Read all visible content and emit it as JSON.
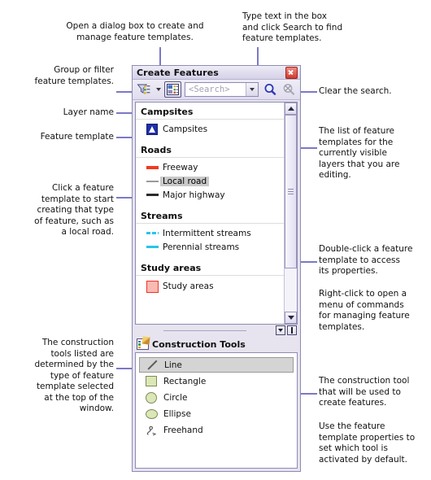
{
  "panel": {
    "title": "Create Features",
    "close_icon": "close-icon",
    "toolbar": {
      "organize_templates_icon": "organize-templates-icon",
      "group_filter_icon": "group-filter-icon",
      "dropdown_caret_icon": "chevron-down-icon",
      "search_placeholder": "<Search>",
      "search_dropdown_icon": "chevron-down-icon",
      "search_button_icon": "search-icon",
      "clear_search_icon": "clear-search-icon"
    },
    "list": {
      "groups": [
        {
          "layer": "Campsites",
          "templates": [
            {
              "label": "Campsites",
              "symbol": "point-marker",
              "selected": false
            }
          ]
        },
        {
          "layer": "Roads",
          "templates": [
            {
              "label": "Freeway",
              "symbol": "line-freeway",
              "selected": false
            },
            {
              "label": "Local road",
              "symbol": "line-local",
              "selected": true
            },
            {
              "label": "Major highway",
              "symbol": "line-major",
              "selected": false
            }
          ]
        },
        {
          "layer": "Streams",
          "templates": [
            {
              "label": "Intermittent streams",
              "symbol": "line-dashed",
              "selected": false
            },
            {
              "label": "Perennial streams",
              "symbol": "line-solid-cyan",
              "selected": false
            }
          ]
        },
        {
          "layer": "Study areas",
          "templates": [
            {
              "label": "Study areas",
              "symbol": "polygon-fill",
              "selected": false
            }
          ]
        }
      ],
      "scrollbar": {
        "up_icon": "chevron-up-icon",
        "down_icon": "chevron-down-icon",
        "thumb_grip_icon": "grip-icon"
      }
    },
    "splitter": {
      "collapse_icon": "double-chevron-down-icon",
      "divider_icon": "divider-bar-icon"
    },
    "construction": {
      "header": "Construction Tools",
      "header_icon": "construction-tools-icon",
      "tools": [
        {
          "label": "Line",
          "icon": "line-tool-icon",
          "selected": true
        },
        {
          "label": "Rectangle",
          "icon": "rectangle-tool-icon",
          "selected": false
        },
        {
          "label": "Circle",
          "icon": "circle-tool-icon",
          "selected": false
        },
        {
          "label": "Ellipse",
          "icon": "ellipse-tool-icon",
          "selected": false
        },
        {
          "label": "Freehand",
          "icon": "freehand-tool-icon",
          "selected": false
        }
      ]
    }
  },
  "annotations": {
    "organize": "Open a dialog box to create and\nmanage feature templates.",
    "search": "Type text in the box\nand click Search to find\nfeature templates.",
    "group_filter": "Group or filter\nfeature templates.",
    "layer_name": "Layer name",
    "feature_template": "Feature template",
    "click_template": "Click a feature\ntemplate to start\ncreating that type\nof feature, such as\na local road.",
    "construction_note": "The construction\ntools listed are\ndetermined by the\ntype of feature\ntemplate selected\nat the top of the\nwindow.",
    "clear_search": "Clear the search.",
    "list_note": "The list of feature\ntemplates for the\ncurrently visible\nlayers that you are\nediting.",
    "double_click": "Double-click a feature\ntemplate to access\nits properties.",
    "right_click": "Right-click to open a\nmenu of commands\nfor managing feature\ntemplates.",
    "tool_note": "The construction tool\nthat will be used to\ncreate features.",
    "tool_default": "Use the feature\ntemplate properties to\nset which tool is\nactivated by default."
  },
  "colors": {
    "leader": "#7b79c6",
    "selection": "#c9c9c9",
    "title_bg": "#e2dff0"
  }
}
